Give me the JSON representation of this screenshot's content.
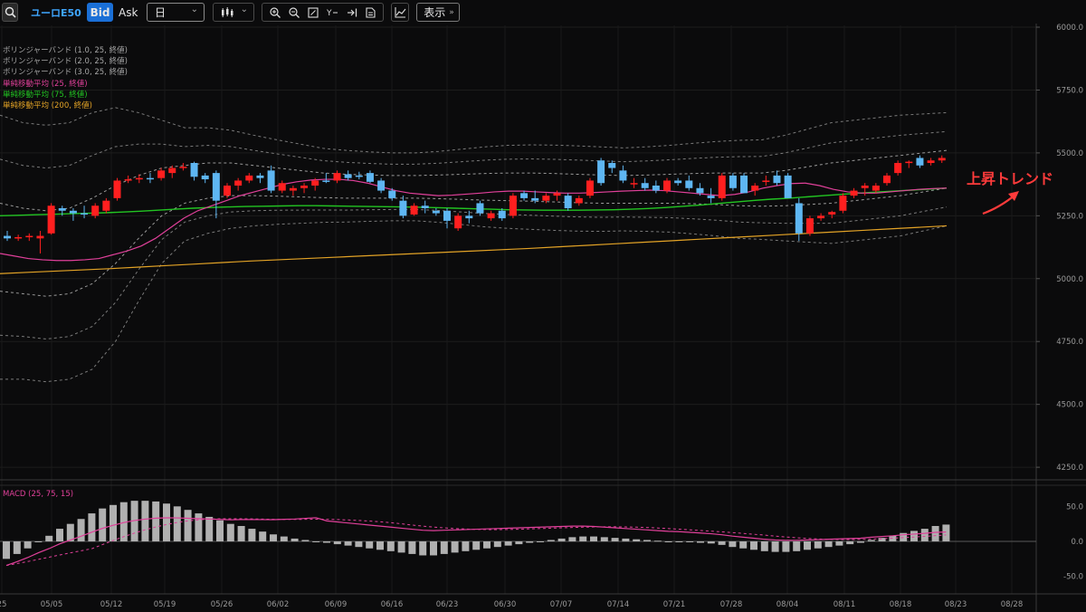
{
  "toolbar": {
    "symbol": "ユーロE50",
    "bid_label": "Bid",
    "ask_label": "Ask",
    "period_value": "日",
    "display_label": "表示"
  },
  "legend": [
    {
      "label": "ボリンジャーバンド (1.0, 25, 終値)",
      "color": "#a6a6a6"
    },
    {
      "label": "ボリンジャーバンド (2.0, 25, 終値)",
      "color": "#a6a6a6"
    },
    {
      "label": "ボリンジャーバンド (3.0, 25, 終値)",
      "color": "#a6a6a6"
    },
    {
      "label": "単純移動平均 (25, 終値)",
      "color": "#e0409a"
    },
    {
      "label": "単純移動平均 (75, 終値)",
      "color": "#22c422"
    },
    {
      "label": "単純移動平均 (200, 終値)",
      "color": "#e3a326"
    }
  ],
  "annotation": "上昇トレンド",
  "price_axis": [
    "6000.0",
    "5750.0",
    "5500.0",
    "5250.0",
    "5000.0",
    "4750.0",
    "4500.0",
    "4250.0"
  ],
  "macd": {
    "label": "MACD (25, 75, 15)",
    "axis": [
      "50.0",
      "0.0",
      "-50.0"
    ]
  },
  "date_axis": [
    "25",
    "05/05",
    "05/12",
    "05/19",
    "05/26",
    "06/02",
    "06/09",
    "06/16",
    "06/23",
    "06/30",
    "07/07",
    "07/14",
    "07/21",
    "07/28",
    "08/04",
    "08/11",
    "08/18",
    "08/23",
    "08/28"
  ],
  "colors": {
    "up": "#ff1f1f",
    "down": "#5eb6f2",
    "sma25": "#e0409a",
    "sma75": "#22c422",
    "sma200": "#e3a326",
    "band": "#9a9a9a",
    "accent": "#1a6fd6",
    "background": "#0b0b0c"
  },
  "chart_data": {
    "type": "candlestick",
    "y_range": [
      4200,
      6000
    ],
    "macd_range": [
      -75,
      75
    ],
    "candles": [
      [
        5170,
        5190,
        5150,
        5160
      ],
      [
        5160,
        5175,
        5150,
        5165
      ],
      [
        5165,
        5180,
        5150,
        5170
      ],
      [
        5160,
        5190,
        5100,
        5170
      ],
      [
        5180,
        5300,
        5175,
        5290
      ],
      [
        5280,
        5290,
        5250,
        5270
      ],
      [
        5270,
        5280,
        5230,
        5260
      ],
      [
        5260,
        5290,
        5240,
        5255
      ],
      [
        5250,
        5300,
        5240,
        5290
      ],
      [
        5270,
        5320,
        5260,
        5310
      ],
      [
        5320,
        5400,
        5310,
        5390
      ],
      [
        5390,
        5410,
        5380,
        5395
      ],
      [
        5395,
        5415,
        5380,
        5400
      ],
      [
        5400,
        5420,
        5380,
        5395
      ],
      [
        5400,
        5440,
        5390,
        5430
      ],
      [
        5420,
        5450,
        5400,
        5440
      ],
      [
        5440,
        5460,
        5430,
        5445
      ],
      [
        5460,
        5465,
        5390,
        5405
      ],
      [
        5410,
        5420,
        5380,
        5395
      ],
      [
        5420,
        5430,
        5240,
        5310
      ],
      [
        5330,
        5380,
        5320,
        5370
      ],
      [
        5370,
        5400,
        5350,
        5390
      ],
      [
        5390,
        5420,
        5380,
        5410
      ],
      [
        5410,
        5420,
        5380,
        5400
      ],
      [
        5430,
        5450,
        5340,
        5350
      ],
      [
        5350,
        5390,
        5340,
        5380
      ],
      [
        5350,
        5370,
        5330,
        5360
      ],
      [
        5360,
        5380,
        5340,
        5370
      ],
      [
        5370,
        5400,
        5350,
        5390
      ],
      [
        5390,
        5420,
        5380,
        5385
      ],
      [
        5390,
        5430,
        5380,
        5420
      ],
      [
        5415,
        5430,
        5390,
        5400
      ],
      [
        5410,
        5425,
        5395,
        5405
      ],
      [
        5420,
        5430,
        5380,
        5385
      ],
      [
        5390,
        5400,
        5340,
        5350
      ],
      [
        5350,
        5360,
        5310,
        5320
      ],
      [
        5310,
        5330,
        5240,
        5250
      ],
      [
        5255,
        5300,
        5250,
        5290
      ],
      [
        5290,
        5310,
        5260,
        5280
      ],
      [
        5270,
        5280,
        5250,
        5260
      ],
      [
        5270,
        5280,
        5200,
        5230
      ],
      [
        5200,
        5260,
        5190,
        5250
      ],
      [
        5250,
        5270,
        5220,
        5240
      ],
      [
        5300,
        5310,
        5250,
        5260
      ],
      [
        5240,
        5270,
        5230,
        5260
      ],
      [
        5270,
        5280,
        5230,
        5240
      ],
      [
        5250,
        5340,
        5240,
        5330
      ],
      [
        5340,
        5350,
        5310,
        5320
      ],
      [
        5320,
        5350,
        5300,
        5310
      ],
      [
        5310,
        5340,
        5300,
        5330
      ],
      [
        5330,
        5350,
        5310,
        5340
      ],
      [
        5330,
        5340,
        5270,
        5280
      ],
      [
        5300,
        5330,
        5290,
        5320
      ],
      [
        5330,
        5400,
        5320,
        5390
      ],
      [
        5470,
        5480,
        5370,
        5380
      ],
      [
        5460,
        5470,
        5420,
        5440
      ],
      [
        5430,
        5450,
        5380,
        5390
      ],
      [
        5380,
        5400,
        5360,
        5380
      ],
      [
        5380,
        5400,
        5350,
        5360
      ],
      [
        5370,
        5390,
        5340,
        5350
      ],
      [
        5350,
        5400,
        5340,
        5390
      ],
      [
        5390,
        5400,
        5370,
        5380
      ],
      [
        5390,
        5410,
        5350,
        5360
      ],
      [
        5360,
        5380,
        5330,
        5340
      ],
      [
        5330,
        5360,
        5300,
        5320
      ],
      [
        5320,
        5420,
        5310,
        5410
      ],
      [
        5410,
        5420,
        5350,
        5360
      ],
      [
        5410,
        5420,
        5340,
        5340
      ],
      [
        5350,
        5380,
        5330,
        5370
      ],
      [
        5390,
        5410,
        5370,
        5390
      ],
      [
        5410,
        5430,
        5370,
        5380
      ],
      [
        5410,
        5420,
        5320,
        5320
      ],
      [
        5300,
        5320,
        5150,
        5180
      ],
      [
        5180,
        5250,
        5170,
        5240
      ],
      [
        5240,
        5260,
        5230,
        5250
      ],
      [
        5255,
        5270,
        5240,
        5265
      ],
      [
        5270,
        5340,
        5260,
        5330
      ],
      [
        5330,
        5360,
        5320,
        5350
      ],
      [
        5360,
        5380,
        5330,
        5370
      ],
      [
        5350,
        5380,
        5340,
        5370
      ],
      [
        5380,
        5420,
        5370,
        5410
      ],
      [
        5420,
        5470,
        5410,
        5460
      ],
      [
        5460,
        5470,
        5440,
        5465
      ],
      [
        5480,
        5490,
        5440,
        5450
      ],
      [
        5460,
        5480,
        5450,
        5470
      ],
      [
        5470,
        5490,
        5460,
        5480
      ],
      [
        5480,
        5490,
        5450,
        5460
      ],
      [
        5460,
        5490,
        5450,
        5480
      ]
    ],
    "sma25": [
      5100,
      5090,
      5080,
      5075,
      5072,
      5072,
      5075,
      5080,
      5095,
      5110,
      5130,
      5160,
      5200,
      5240,
      5270,
      5290,
      5310,
      5330,
      5345,
      5360,
      5375,
      5385,
      5392,
      5395,
      5395,
      5390,
      5380,
      5365,
      5350,
      5340,
      5335,
      5330,
      5332,
      5336,
      5340,
      5345,
      5348,
      5348,
      5345,
      5342,
      5340,
      5340,
      5342,
      5345,
      5348,
      5350,
      5352,
      5350,
      5345,
      5340,
      5335,
      5330,
      5335,
      5345,
      5360,
      5370,
      5378,
      5380,
      5370,
      5355,
      5345,
      5340,
      5340,
      5345,
      5350,
      5355,
      5358,
      5360
    ],
    "sma75": [
      5250,
      5252,
      5254,
      5256,
      5258,
      5260,
      5262,
      5265,
      5268,
      5272,
      5276,
      5280,
      5283,
      5285,
      5287,
      5288,
      5289,
      5290,
      5290,
      5289,
      5288,
      5287,
      5286,
      5285,
      5284,
      5282,
      5280,
      5278,
      5276,
      5274,
      5273,
      5272,
      5272,
      5272,
      5273,
      5274,
      5276,
      5279,
      5283,
      5288,
      5293,
      5299,
      5305,
      5311,
      5316,
      5320,
      5325,
      5330,
      5335,
      5340,
      5344,
      5348,
      5352,
      5356,
      5360
    ],
    "sma200": [
      5020,
      5025,
      5030,
      5035,
      5040,
      5046,
      5052,
      5058,
      5064,
      5070,
      5075,
      5080,
      5085,
      5090,
      5095,
      5100,
      5105,
      5110,
      5115,
      5120,
      5126,
      5132,
      5138,
      5144,
      5150,
      5156,
      5162,
      5168,
      5174,
      5180,
      5186,
      5192,
      5198,
      5204,
      5210
    ],
    "bb1_upper": [
      5300,
      5280,
      5270,
      5280,
      5320,
      5370,
      5410,
      5440,
      5450,
      5460,
      5460,
      5450,
      5440,
      5430,
      5420,
      5415,
      5412,
      5410,
      5410,
      5412,
      5415,
      5418,
      5420,
      5420,
      5418,
      5415,
      5412,
      5410,
      5412,
      5415,
      5418,
      5420,
      5420,
      5420,
      5430,
      5445,
      5460,
      5470,
      5480,
      5490,
      5500,
      5510
    ],
    "bb1_lower": [
      4950,
      4940,
      4930,
      4940,
      4980,
      5060,
      5160,
      5250,
      5300,
      5320,
      5330,
      5330,
      5328,
      5325,
      5322,
      5320,
      5320,
      5320,
      5320,
      5318,
      5315,
      5312,
      5310,
      5308,
      5305,
      5302,
      5300,
      5300,
      5300,
      5300,
      5298,
      5295,
      5290,
      5288,
      5290,
      5295,
      5300,
      5310,
      5320,
      5330,
      5345,
      5360
    ],
    "macd_hist": [
      -25,
      -18,
      -10,
      0,
      8,
      18,
      25,
      32,
      40,
      47,
      52,
      56,
      58,
      58,
      57,
      54,
      50,
      45,
      40,
      35,
      30,
      25,
      22,
      18,
      14,
      10,
      7,
      4,
      2,
      0,
      -2,
      -4,
      -6,
      -8,
      -10,
      -12,
      -14,
      -16,
      -18,
      -20,
      -20,
      -18,
      -16,
      -14,
      -12,
      -10,
      -8,
      -6,
      -4,
      -2,
      0,
      2,
      4,
      6,
      7,
      7,
      6,
      5,
      4,
      3,
      2,
      1,
      0,
      0,
      -1,
      -2,
      -3,
      -5,
      -8,
      -10,
      -12,
      -14,
      -15,
      -15,
      -14,
      -12,
      -10,
      -8,
      -6,
      -4,
      -2,
      2,
      5,
      8,
      12,
      15,
      18,
      22,
      24
    ]
  }
}
